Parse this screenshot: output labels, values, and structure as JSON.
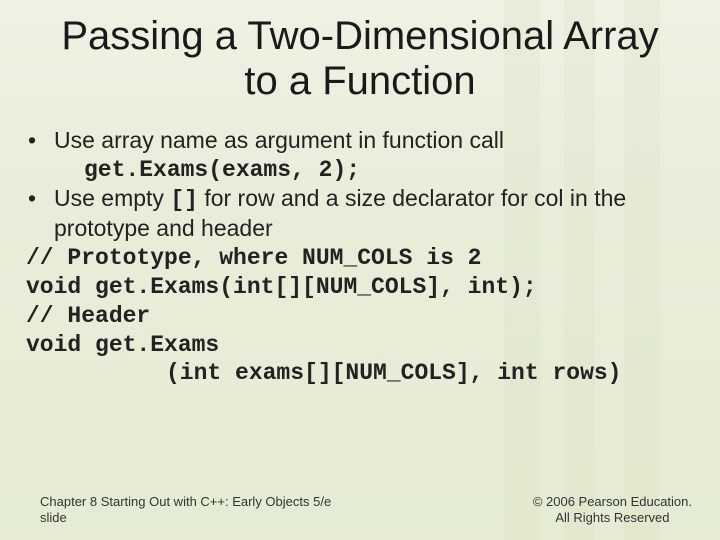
{
  "title": "Passing a Two-Dimensional Array to a Function",
  "bullets": {
    "b1": "Use array name as argument in function call",
    "b1code": "get.Exams(exams, 2);",
    "b2a": "Use empty ",
    "b2code": "[]",
    "b2b": " for row and a size declarator for col in the prototype and header"
  },
  "code": {
    "c1": "// Prototype, where NUM_COLS is 2",
    "c2": "void get.Exams(int[][NUM_COLS], int);",
    "c3": "// Header",
    "c4": "void get.Exams",
    "c5": "(int exams[][NUM_COLS], int rows)"
  },
  "footer": {
    "left1": "Chapter 8 Starting Out with C++: Early Objects 5/e",
    "left2": "slide",
    "right1": "© 2006 Pearson Education.",
    "right2": "All Rights Reserved"
  }
}
